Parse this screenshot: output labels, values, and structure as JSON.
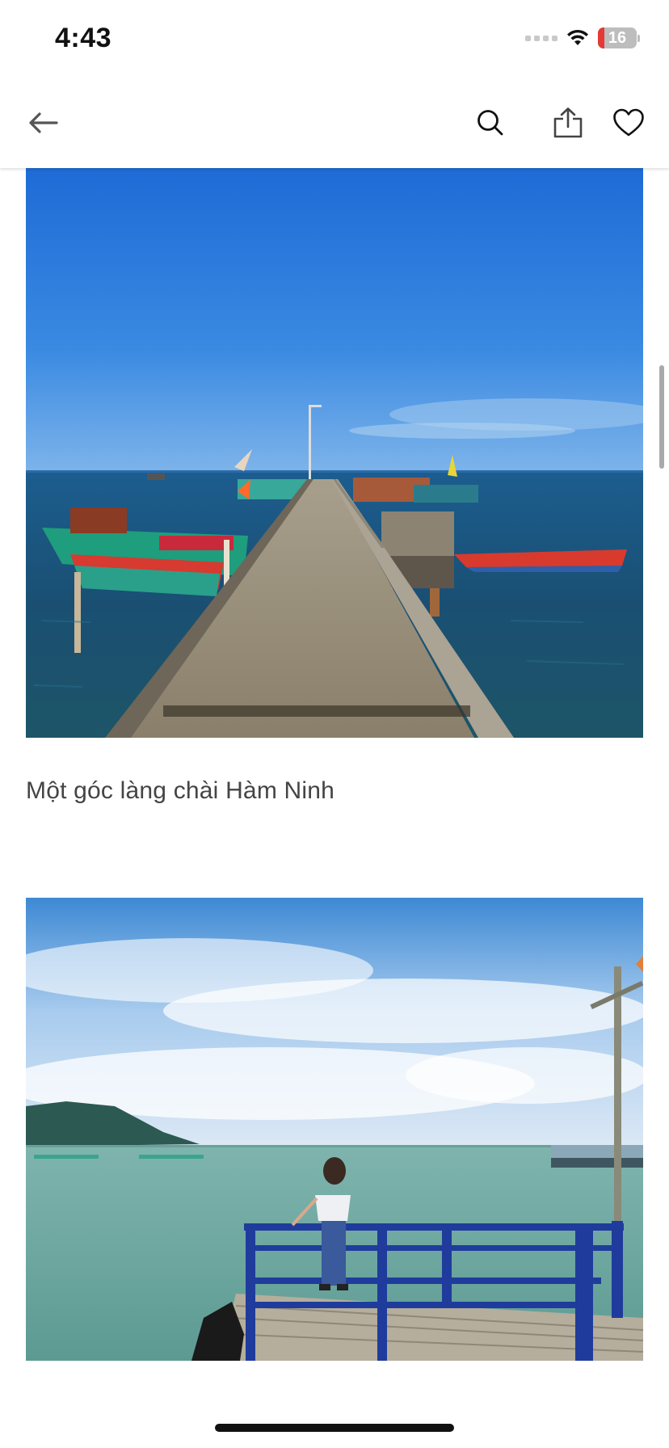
{
  "status_bar": {
    "time": "4:43",
    "battery_level": "16"
  },
  "nav": {
    "back_icon": "arrow-left-icon",
    "search_icon": "search-icon",
    "share_icon": "share-icon",
    "favorite_icon": "heart-icon"
  },
  "article": {
    "photos": [
      {
        "subject": "concrete pier with fishing boats",
        "caption": "Một góc làng chài Hàm Ninh"
      },
      {
        "subject": "woman on blue wooden railing jetty facing sea"
      }
    ]
  },
  "colors": {
    "accent": "#111111",
    "caption_text": "#444444",
    "battery_low": "#e53935"
  }
}
